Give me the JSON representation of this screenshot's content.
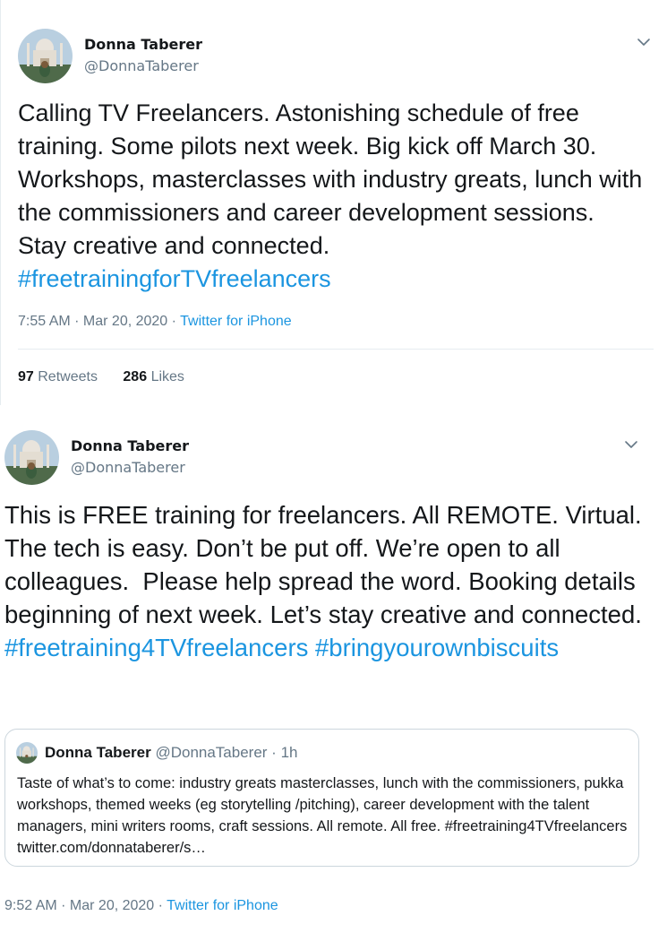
{
  "tweets": [
    {
      "author": {
        "name": "Donna Taberer",
        "handle": "@DonnaTaberer"
      },
      "text": "Calling TV Freelancers. Astonishing schedule of free training. Some pilots next week. Big kick off March 30. Workshops, masterclasses with industry greats, lunch with the commissioners and career development sessions. Stay creative and connected. ",
      "hashtag": "#freetrainingforTVfreelancers",
      "time": "7:55 AM",
      "separator": " · ",
      "date": "Mar 20, 2020",
      "source": "Twitter for iPhone",
      "retweets": {
        "count": "97",
        "label": "Retweets"
      },
      "likes": {
        "count": "286",
        "label": "Likes"
      },
      "menu_icon": "chevron-down-icon"
    },
    {
      "author": {
        "name": "Donna Taberer",
        "handle": "@DonnaTaberer"
      },
      "text": "This is FREE training for freelancers. All REMOTE. Virtual. The tech is easy. Don’t be put off. We’re open to all colleagues.  Please help spread the word. Booking details beginning of next week. Let’s stay creative and connected. ",
      "hashtag1": "#freetraining4TVfreelancers",
      "hashtag2": "#bringyourownbiscuits",
      "time": "9:52 AM",
      "separator": " · ",
      "date": "Mar 20, 2020",
      "source": "Twitter for iPhone",
      "menu_icon": "chevron-down-icon",
      "quote": {
        "name": "Donna Taberer",
        "handle": "@DonnaTaberer",
        "age": "1h",
        "dot": " · ",
        "text": "Taste of what’s to come: industry greats masterclasses, lunch with the commissioners, pukka workshops, themed weeks (eg storytelling /pitching), career development with the talent managers, mini writers rooms, craft sessions. All remote. All free. #freetraining4TVfreelancers twitter.com/donnataberer/s…"
      }
    }
  ],
  "colors": {
    "link": "#1b95e0",
    "secondary_text": "#657786",
    "primary_text": "#14171a",
    "border": "#e6ecf0"
  }
}
